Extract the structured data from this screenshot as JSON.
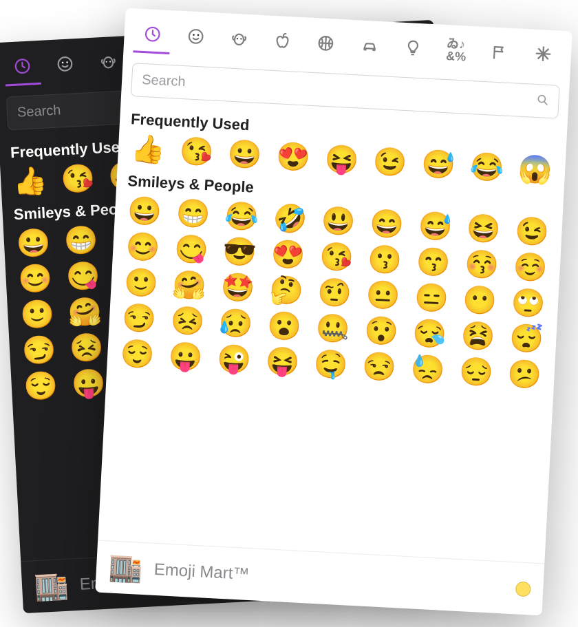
{
  "accent_color": "#a24bdb",
  "tabs": [
    {
      "id": "recent",
      "label": "Frequently Used"
    },
    {
      "id": "smileys",
      "label": "Smileys & People"
    },
    {
      "id": "animals",
      "label": "Animals & Nature"
    },
    {
      "id": "food",
      "label": "Food & Drink"
    },
    {
      "id": "activity",
      "label": "Activity"
    },
    {
      "id": "travel",
      "label": "Travel & Places"
    },
    {
      "id": "objects",
      "label": "Objects"
    },
    {
      "id": "symbols",
      "label": "Symbols"
    },
    {
      "id": "flags",
      "label": "Flags"
    },
    {
      "id": "custom",
      "label": "Custom"
    }
  ],
  "search": {
    "placeholder": "Search"
  },
  "sections": {
    "frequent": {
      "title": "Frequently Used",
      "emojis": [
        "👍",
        "😘",
        "😀",
        "😍",
        "😝",
        "😉",
        "😅",
        "😂",
        "😱"
      ]
    },
    "smileys": {
      "title": "Smileys & People",
      "emojis": [
        "😀",
        "😁",
        "😂",
        "🤣",
        "😃",
        "😄",
        "😅",
        "😆",
        "😉",
        "😊",
        "😋",
        "😎",
        "😍",
        "😘",
        "😗",
        "😙",
        "😚",
        "☺️",
        "🙂",
        "🤗",
        "🤩",
        "🤔",
        "🤨",
        "😐",
        "😑",
        "😶",
        "🙄",
        "😏",
        "😣",
        "😥",
        "😮",
        "🤐",
        "😯",
        "😪",
        "😫",
        "😴",
        "😌",
        "😛",
        "😜",
        "😝",
        "🤤",
        "😒",
        "😓",
        "😔",
        "😕"
      ]
    }
  },
  "footer": {
    "preview_emoji": "🏬",
    "label": "Emoji Mart™"
  }
}
